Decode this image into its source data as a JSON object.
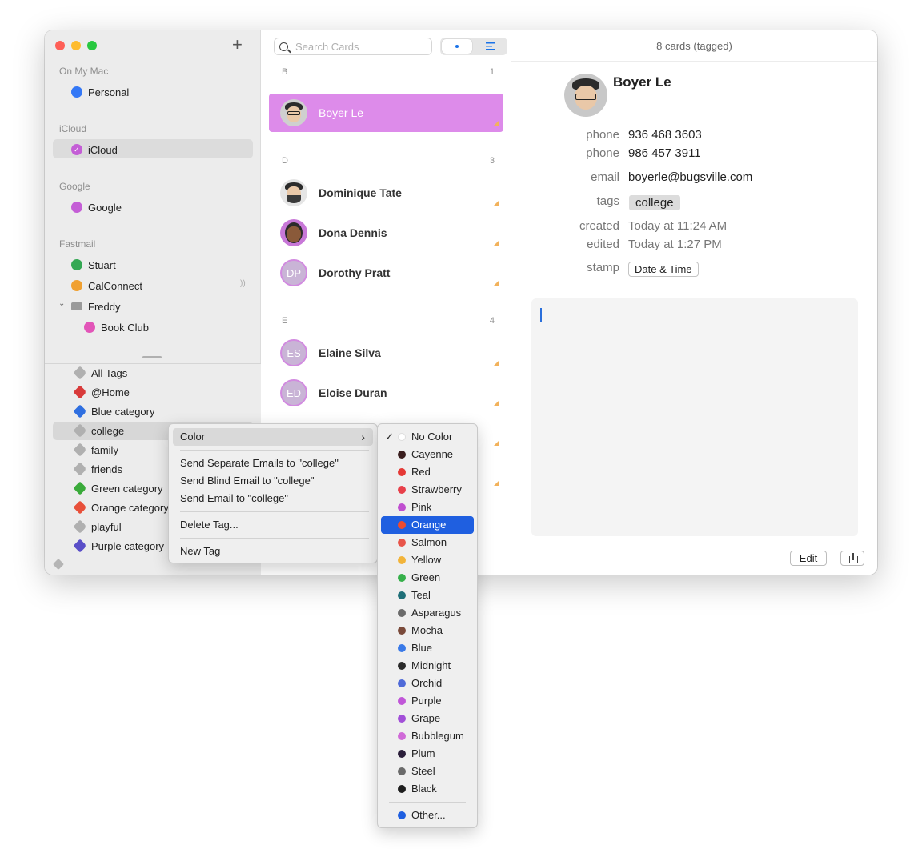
{
  "sidebar": {
    "add_label": "+",
    "sections": [
      {
        "title": "On My Mac",
        "items": [
          {
            "label": "Personal",
            "color": "#3478f6"
          }
        ]
      },
      {
        "title": "iCloud",
        "items": [
          {
            "label": "iCloud",
            "color": "#c45ed6"
          }
        ]
      },
      {
        "title": "Google",
        "items": [
          {
            "label": "Google",
            "color": "#c45ed6"
          }
        ]
      },
      {
        "title": "Fastmail",
        "items": [
          {
            "label": "Stuart",
            "color": "#34a853"
          },
          {
            "label": "CalConnect",
            "color": "#f0a030"
          },
          {
            "label": "Freddy",
            "color": "#9a9a9a"
          },
          {
            "label": "Book Club",
            "color": "#e255b8"
          }
        ]
      }
    ],
    "tags": [
      {
        "label": "All Tags",
        "color": "#b0b0b0"
      },
      {
        "label": "@Home",
        "color": "#d83a3a"
      },
      {
        "label": "Blue category",
        "color": "#2f6fe0"
      },
      {
        "label": "college",
        "color": "#b0b0b0"
      },
      {
        "label": "family",
        "color": "#b0b0b0"
      },
      {
        "label": "friends",
        "color": "#b0b0b0"
      },
      {
        "label": "Green category",
        "color": "#3aaa3a"
      },
      {
        "label": "Orange category",
        "color": "#e8503a"
      },
      {
        "label": "playful",
        "color": "#b0b0b0"
      },
      {
        "label": "Purple category",
        "color": "#5a4fc8"
      }
    ]
  },
  "list": {
    "search_placeholder": "Search Cards",
    "groups": [
      {
        "letter": "B",
        "count": "1"
      },
      {
        "letter": "D",
        "count": "3"
      },
      {
        "letter": "E",
        "count": "4"
      }
    ],
    "cards": [
      {
        "name": "Boyer Le",
        "initials": ""
      },
      {
        "name": "Dominique Tate",
        "initials": ""
      },
      {
        "name": "Dona Dennis",
        "initials": ""
      },
      {
        "name": "Dorothy Pratt",
        "initials": "DP"
      },
      {
        "name": "Elaine Silva",
        "initials": "ES"
      },
      {
        "name": "Eloise Duran",
        "initials": "ED"
      }
    ]
  },
  "detail": {
    "cards_count": "8 cards (tagged)",
    "name": "Boyer Le",
    "fields": [
      {
        "label": "phone",
        "value": "936 468 3603"
      },
      {
        "label": "phone",
        "value": "986 457 3911"
      },
      {
        "label": "email",
        "value": "boyerle@bugsville.com"
      },
      {
        "label": "tags",
        "value": "college"
      },
      {
        "label": "created",
        "value": "Today at 11:24 AM"
      },
      {
        "label": "edited",
        "value": "Today at 1:27 PM"
      },
      {
        "label": "stamp",
        "value": "Date & Time"
      }
    ],
    "edit_label": "Edit"
  },
  "context_menu": {
    "items": [
      {
        "label": "Color"
      },
      {
        "label": "Send Separate Emails to \"college\""
      },
      {
        "label": "Send Blind Email to \"college\""
      },
      {
        "label": "Send Email to \"college\""
      },
      {
        "label": "Delete Tag..."
      },
      {
        "label": "New Tag"
      }
    ],
    "submenu_arrow": "›"
  },
  "color_menu": {
    "check": "✓",
    "selected": "Orange",
    "items": [
      {
        "label": "No Color",
        "color": "#ffffff"
      },
      {
        "label": "Cayenne",
        "color": "#3a1e1e"
      },
      {
        "label": "Red",
        "color": "#e53935"
      },
      {
        "label": "Strawberry",
        "color": "#e8404a"
      },
      {
        "label": "Pink",
        "color": "#c04fd0"
      },
      {
        "label": "Orange",
        "color": "#ef4b2e"
      },
      {
        "label": "Salmon",
        "color": "#e8554a"
      },
      {
        "label": "Yellow",
        "color": "#f2b43a"
      },
      {
        "label": "Green",
        "color": "#36b04a"
      },
      {
        "label": "Teal",
        "color": "#1f6f78"
      },
      {
        "label": "Asparagus",
        "color": "#6b6b6b"
      },
      {
        "label": "Mocha",
        "color": "#7a4a3a"
      },
      {
        "label": "Blue",
        "color": "#3a7ae8"
      },
      {
        "label": "Midnight",
        "color": "#2a2a2a"
      },
      {
        "label": "Orchid",
        "color": "#4f6ad8"
      },
      {
        "label": "Purple",
        "color": "#c056d8"
      },
      {
        "label": "Grape",
        "color": "#a24fd8"
      },
      {
        "label": "Bubblegum",
        "color": "#d06ad8"
      },
      {
        "label": "Plum",
        "color": "#2b1e3a"
      },
      {
        "label": "Steel",
        "color": "#6a6a6a"
      },
      {
        "label": "Black",
        "color": "#1e1e1e"
      },
      {
        "label": "Other...",
        "color": "#1f5fe0"
      }
    ]
  }
}
